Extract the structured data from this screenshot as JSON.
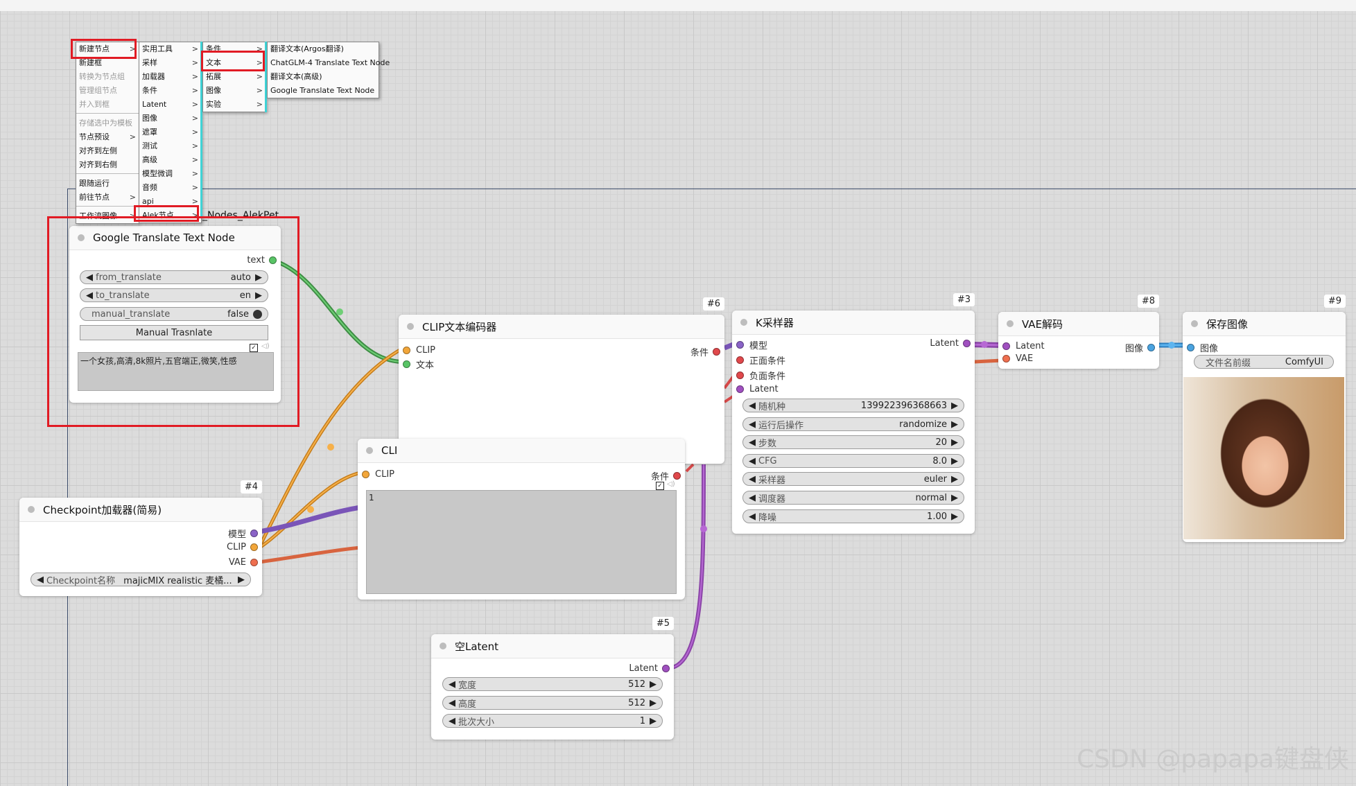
{
  "group": {
    "title": "_Nodes_AlekPet"
  },
  "context_menu": {
    "level1": [
      {
        "label": "新建节点",
        "submenu": true,
        "disabled": false
      },
      {
        "label": "新建框",
        "submenu": false,
        "disabled": false
      },
      {
        "label": "转换为节点组",
        "submenu": false,
        "disabled": true
      },
      {
        "label": "管理组节点",
        "submenu": false,
        "disabled": true
      },
      {
        "label": "并入到框",
        "submenu": false,
        "disabled": true
      },
      {
        "label": "存储选中为模板",
        "submenu": false,
        "disabled": true
      },
      {
        "label": "节点预设",
        "submenu": true,
        "disabled": false
      },
      {
        "label": "对齐到左侧",
        "submenu": false,
        "disabled": false
      },
      {
        "label": "对齐到右侧",
        "submenu": false,
        "disabled": false
      },
      {
        "label": "跟随运行",
        "submenu": false,
        "disabled": false
      },
      {
        "label": "前往节点",
        "submenu": true,
        "disabled": false
      },
      {
        "label": "工作流图像",
        "submenu": true,
        "disabled": false
      }
    ],
    "level2": [
      "实用工具",
      "采样",
      "加载器",
      "条件",
      "Latent",
      "图像",
      "遮罩",
      "测试",
      "高级",
      "模型微调",
      "音频",
      "api",
      "Alek节点"
    ],
    "level3": [
      "条件",
      "文本",
      "拓展",
      "图像",
      "实验"
    ],
    "level4": [
      "翻译文本(Argos翻译)",
      "ChatGLM-4 Translate Text Node",
      "翻译文本(高级)",
      "Google Translate Text Node"
    ],
    "submenu_arrow": ">"
  },
  "nodes": {
    "google": {
      "title": "Google Translate Text Node",
      "output": "text",
      "from_label": "from_translate",
      "from_value": "auto",
      "to_label": "to_translate",
      "to_value": "en",
      "manual_label": "manual_translate",
      "manual_value": "false",
      "button": "Manual Trasnlate",
      "text": "一个女孩,高清,8k照片,五官端正,微笑,性感"
    },
    "clip6": {
      "id": "#6",
      "title": "CLIP文本编码器",
      "in_clip": "CLIP",
      "in_text": "文本",
      "out": "条件"
    },
    "clip7": {
      "title": "CLI",
      "in_clip": "CLIP",
      "out": "条件",
      "text": "1"
    },
    "ksampler": {
      "id": "#3",
      "title": "K采样器",
      "inputs": [
        "模型",
        "正面条件",
        "负面条件",
        "Latent"
      ],
      "output": "Latent",
      "widgets": [
        {
          "label": "随机种",
          "value": "139922396368663"
        },
        {
          "label": "运行后操作",
          "value": "randomize"
        },
        {
          "label": "步数",
          "value": "20"
        },
        {
          "label": "CFG",
          "value": "8.0"
        },
        {
          "label": "采样器",
          "value": "euler"
        },
        {
          "label": "调度器",
          "value": "normal"
        },
        {
          "label": "降噪",
          "value": "1.00"
        }
      ]
    },
    "vae": {
      "id": "#8",
      "title": "VAE解码",
      "in_latent": "Latent",
      "in_vae": "VAE",
      "out": "图像"
    },
    "save": {
      "id": "#9",
      "title": "保存图像",
      "input": "图像",
      "prefix_label": "文件名前缀",
      "prefix_value": "ComfyUI"
    },
    "checkpoint": {
      "id": "#4",
      "title": "Checkpoint加载器(简易)",
      "outputs": [
        "模型",
        "CLIP",
        "VAE"
      ],
      "ckpt_label": "Checkpoint名称",
      "ckpt_value": "majicMIX realistic 麦橘..."
    },
    "latent": {
      "id": "#5",
      "title": "空Latent",
      "output": "Latent",
      "widgets": [
        {
          "label": "宽度",
          "value": "512"
        },
        {
          "label": "高度",
          "value": "512"
        },
        {
          "label": "批次大小",
          "value": "1"
        }
      ]
    }
  },
  "colors": {
    "model": "#8a63c7",
    "clip": "#f2a63a",
    "conditioning": "#e0484b",
    "latent": "#a050c0",
    "vae": "#ef6f4f",
    "image": "#4aa3e0",
    "text": "#59c466",
    "highlight": "#e11b24"
  },
  "watermark": "CSDN @papapa键盘侠"
}
